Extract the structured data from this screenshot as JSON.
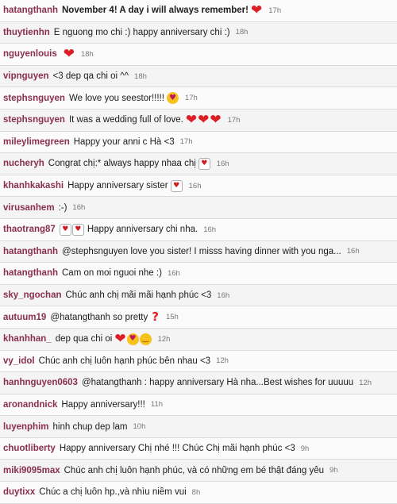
{
  "colors": {
    "username": "#8a2f4c",
    "text": "#1c1c1c",
    "timestamp": "#777777",
    "heart": "#dc1f26",
    "row_border": "#dcdcdc"
  },
  "comments": [
    {
      "user": "hatangthanh",
      "text": "November 4! A day i will always remember!",
      "strong": true,
      "emojis": [
        "heart-icon"
      ],
      "time": "17h"
    },
    {
      "user": "thuytienhn",
      "text": "E nguong mo chi :) happy anniversary chi :)",
      "emojis": [],
      "time": "18h"
    },
    {
      "user": "nguyenlouis",
      "text": "",
      "emojis": [
        "heart-icon"
      ],
      "time": "18h"
    },
    {
      "user": "vipnguyen",
      "text": "<3 dep qa chi oi ^^",
      "emojis": [],
      "time": "18h"
    },
    {
      "user": "stephsnguyen",
      "text": "We love you seestor!!!!!",
      "emojis": [
        "face-blowing-kiss-icon"
      ],
      "time": "17h"
    },
    {
      "user": "stephsnguyen",
      "text": "It was a wedding full of love.",
      "emojis": [
        "heart-icon",
        "heart-icon",
        "heart-icon"
      ],
      "time": "17h"
    },
    {
      "user": "mileylimegreen",
      "text": "Happy your anni c Hà <3",
      "emojis": [],
      "time": "17h"
    },
    {
      "user": "nucheryh",
      "text": "Congrat chị:* always happy nhaa chị",
      "emojis": [
        "heart-box-icon"
      ],
      "time": "16h"
    },
    {
      "user": "khanhkakashi",
      "text": "Happy anniversary sister",
      "emojis": [
        "heart-box-icon"
      ],
      "time": "16h"
    },
    {
      "user": "virusanhem",
      "text": ":-)",
      "emojis": [],
      "time": "16h"
    },
    {
      "user": "thaotrang87",
      "text": "Happy anniversary chi nha.",
      "emojis_before": [
        "heart-box-icon",
        "heart-box-icon"
      ],
      "emojis": [],
      "time": "16h"
    },
    {
      "user": "hatangthanh",
      "text": "@stephsnguyen love you sister! I misss having dinner with you nga...",
      "emojis": [],
      "time": "16h"
    },
    {
      "user": "hatangthanh",
      "text": "Cam on moi nguoi nhe :)",
      "emojis": [],
      "time": "16h"
    },
    {
      "user": "sky_ngochan",
      "text": "Chúc anh chị mãi mãi hạnh phúc <3",
      "emojis": [],
      "time": "16h"
    },
    {
      "user": "autuum19",
      "text": "@hatangthanh so pretty",
      "emojis": [
        "question-mark-icon"
      ],
      "time": "15h"
    },
    {
      "user": "khanhhan_",
      "text": "dep qua chi oi",
      "emojis": [
        "heart-icon",
        "heart-eyes-face-icon",
        "smiling-face-icon"
      ],
      "time": "12h"
    },
    {
      "user": "vy_idol",
      "text": "Chúc anh chị luôn hạnh phúc bên nhau <3",
      "emojis": [],
      "time": "12h"
    },
    {
      "user": "hanhnguyen0603",
      "text": "@hatangthanh : happy anniversary Hà nha...Best wishes for uuuuu",
      "emojis": [],
      "time": "12h"
    },
    {
      "user": "aronandnick",
      "text": "Happy anniversary!!!",
      "emojis": [],
      "time": "11h"
    },
    {
      "user": "luyenphim",
      "text": "hinh chup dep lam",
      "emojis": [],
      "time": "10h"
    },
    {
      "user": "chuotliberty",
      "text": "Happy anniversary Chị nhé !!! Chúc Chị mãi hạnh phúc <3",
      "emojis": [],
      "time": "9h"
    },
    {
      "user": "miki9095max",
      "text": "Chúc anh chị luôn hạnh phúc, và có những em bé thật đáng yêu",
      "emojis": [],
      "time": "9h"
    },
    {
      "user": "duytixx",
      "text": "Chúc a chị luôn hp.,và nhìu niềm vui",
      "emojis": [],
      "time": "8h"
    }
  ]
}
